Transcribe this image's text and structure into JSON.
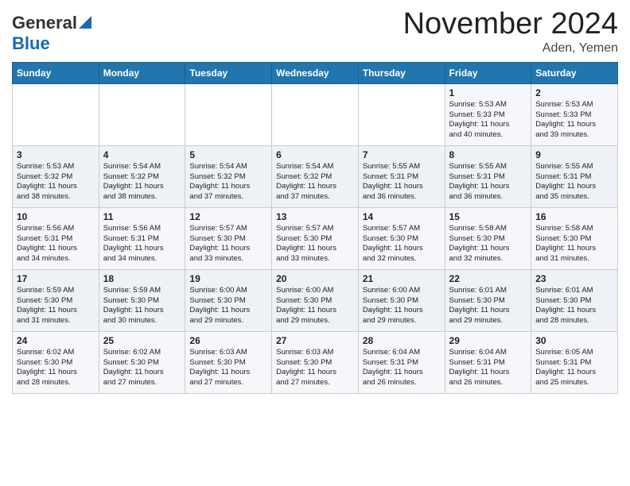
{
  "header": {
    "logo_general": "General",
    "logo_blue": "Blue",
    "month_title": "November 2024",
    "location": "Aden, Yemen"
  },
  "weekdays": [
    "Sunday",
    "Monday",
    "Tuesday",
    "Wednesday",
    "Thursday",
    "Friday",
    "Saturday"
  ],
  "weeks": [
    [
      {
        "day": "",
        "info": ""
      },
      {
        "day": "",
        "info": ""
      },
      {
        "day": "",
        "info": ""
      },
      {
        "day": "",
        "info": ""
      },
      {
        "day": "",
        "info": ""
      },
      {
        "day": "1",
        "info": "Sunrise: 5:53 AM\nSunset: 5:33 PM\nDaylight: 11 hours\nand 40 minutes."
      },
      {
        "day": "2",
        "info": "Sunrise: 5:53 AM\nSunset: 5:33 PM\nDaylight: 11 hours\nand 39 minutes."
      }
    ],
    [
      {
        "day": "3",
        "info": "Sunrise: 5:53 AM\nSunset: 5:32 PM\nDaylight: 11 hours\nand 38 minutes."
      },
      {
        "day": "4",
        "info": "Sunrise: 5:54 AM\nSunset: 5:32 PM\nDaylight: 11 hours\nand 38 minutes."
      },
      {
        "day": "5",
        "info": "Sunrise: 5:54 AM\nSunset: 5:32 PM\nDaylight: 11 hours\nand 37 minutes."
      },
      {
        "day": "6",
        "info": "Sunrise: 5:54 AM\nSunset: 5:32 PM\nDaylight: 11 hours\nand 37 minutes."
      },
      {
        "day": "7",
        "info": "Sunrise: 5:55 AM\nSunset: 5:31 PM\nDaylight: 11 hours\nand 36 minutes."
      },
      {
        "day": "8",
        "info": "Sunrise: 5:55 AM\nSunset: 5:31 PM\nDaylight: 11 hours\nand 36 minutes."
      },
      {
        "day": "9",
        "info": "Sunrise: 5:55 AM\nSunset: 5:31 PM\nDaylight: 11 hours\nand 35 minutes."
      }
    ],
    [
      {
        "day": "10",
        "info": "Sunrise: 5:56 AM\nSunset: 5:31 PM\nDaylight: 11 hours\nand 34 minutes."
      },
      {
        "day": "11",
        "info": "Sunrise: 5:56 AM\nSunset: 5:31 PM\nDaylight: 11 hours\nand 34 minutes."
      },
      {
        "day": "12",
        "info": "Sunrise: 5:57 AM\nSunset: 5:30 PM\nDaylight: 11 hours\nand 33 minutes."
      },
      {
        "day": "13",
        "info": "Sunrise: 5:57 AM\nSunset: 5:30 PM\nDaylight: 11 hours\nand 33 minutes."
      },
      {
        "day": "14",
        "info": "Sunrise: 5:57 AM\nSunset: 5:30 PM\nDaylight: 11 hours\nand 32 minutes."
      },
      {
        "day": "15",
        "info": "Sunrise: 5:58 AM\nSunset: 5:30 PM\nDaylight: 11 hours\nand 32 minutes."
      },
      {
        "day": "16",
        "info": "Sunrise: 5:58 AM\nSunset: 5:30 PM\nDaylight: 11 hours\nand 31 minutes."
      }
    ],
    [
      {
        "day": "17",
        "info": "Sunrise: 5:59 AM\nSunset: 5:30 PM\nDaylight: 11 hours\nand 31 minutes."
      },
      {
        "day": "18",
        "info": "Sunrise: 5:59 AM\nSunset: 5:30 PM\nDaylight: 11 hours\nand 30 minutes."
      },
      {
        "day": "19",
        "info": "Sunrise: 6:00 AM\nSunset: 5:30 PM\nDaylight: 11 hours\nand 29 minutes."
      },
      {
        "day": "20",
        "info": "Sunrise: 6:00 AM\nSunset: 5:30 PM\nDaylight: 11 hours\nand 29 minutes."
      },
      {
        "day": "21",
        "info": "Sunrise: 6:00 AM\nSunset: 5:30 PM\nDaylight: 11 hours\nand 29 minutes."
      },
      {
        "day": "22",
        "info": "Sunrise: 6:01 AM\nSunset: 5:30 PM\nDaylight: 11 hours\nand 29 minutes."
      },
      {
        "day": "23",
        "info": "Sunrise: 6:01 AM\nSunset: 5:30 PM\nDaylight: 11 hours\nand 28 minutes."
      }
    ],
    [
      {
        "day": "24",
        "info": "Sunrise: 6:02 AM\nSunset: 5:30 PM\nDaylight: 11 hours\nand 28 minutes."
      },
      {
        "day": "25",
        "info": "Sunrise: 6:02 AM\nSunset: 5:30 PM\nDaylight: 11 hours\nand 27 minutes."
      },
      {
        "day": "26",
        "info": "Sunrise: 6:03 AM\nSunset: 5:30 PM\nDaylight: 11 hours\nand 27 minutes."
      },
      {
        "day": "27",
        "info": "Sunrise: 6:03 AM\nSunset: 5:30 PM\nDaylight: 11 hours\nand 27 minutes."
      },
      {
        "day": "28",
        "info": "Sunrise: 6:04 AM\nSunset: 5:31 PM\nDaylight: 11 hours\nand 26 minutes."
      },
      {
        "day": "29",
        "info": "Sunrise: 6:04 AM\nSunset: 5:31 PM\nDaylight: 11 hours\nand 26 minutes."
      },
      {
        "day": "30",
        "info": "Sunrise: 6:05 AM\nSunset: 5:31 PM\nDaylight: 11 hours\nand 25 minutes."
      }
    ]
  ]
}
